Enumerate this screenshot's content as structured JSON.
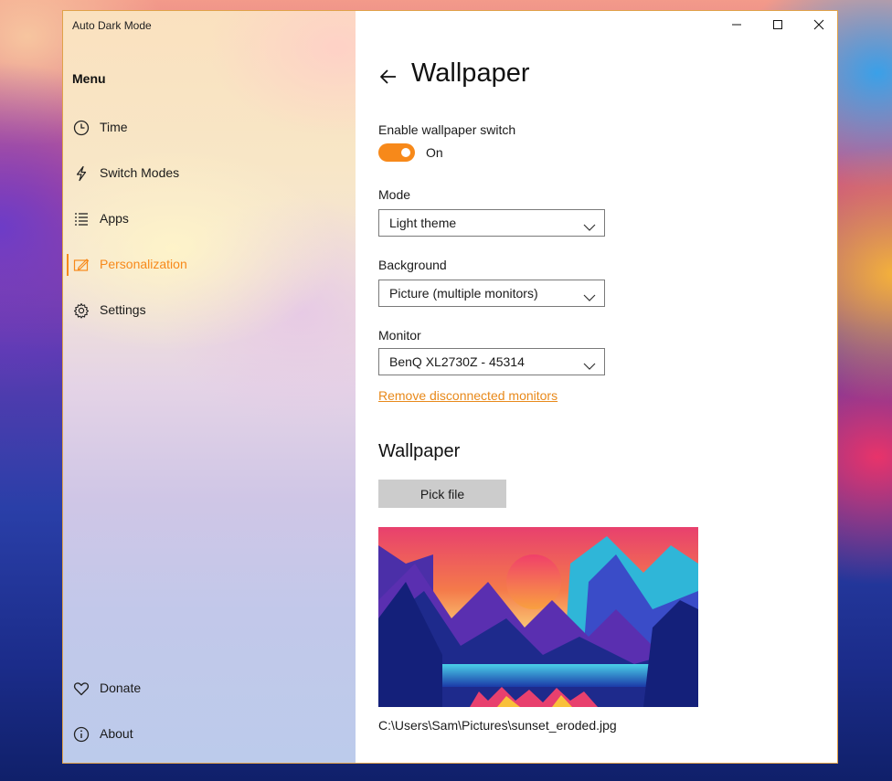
{
  "window": {
    "title": "Auto Dark Mode",
    "accent_color": "#f7891a"
  },
  "sidebar": {
    "heading": "Menu",
    "items": [
      {
        "label": "Time",
        "icon": "clock-icon",
        "active": false
      },
      {
        "label": "Switch Modes",
        "icon": "lightning-icon",
        "active": false
      },
      {
        "label": "Apps",
        "icon": "list-icon",
        "active": false
      },
      {
        "label": "Personalization",
        "icon": "personalization-icon",
        "active": true
      },
      {
        "label": "Settings",
        "icon": "gear-icon",
        "active": false
      }
    ],
    "footer_items": [
      {
        "label": "Donate",
        "icon": "heart-icon"
      },
      {
        "label": "About",
        "icon": "info-icon"
      }
    ]
  },
  "caption_buttons": [
    "minimize-icon",
    "maximize-icon",
    "close-icon"
  ],
  "page": {
    "title": "Wallpaper",
    "enable_label": "Enable wallpaper switch",
    "toggle_state": "On",
    "toggle_on": true,
    "mode_label": "Mode",
    "mode_value": "Light theme",
    "background_label": "Background",
    "background_value": "Picture (multiple monitors)",
    "monitor_label": "Monitor",
    "monitor_value": "BenQ XL2730Z - 45314",
    "remove_link": "Remove disconnected monitors",
    "section_title": "Wallpaper",
    "pick_button": "Pick file",
    "file_path": "C:\\Users\\Sam\\Pictures\\sunset_eroded.jpg"
  }
}
